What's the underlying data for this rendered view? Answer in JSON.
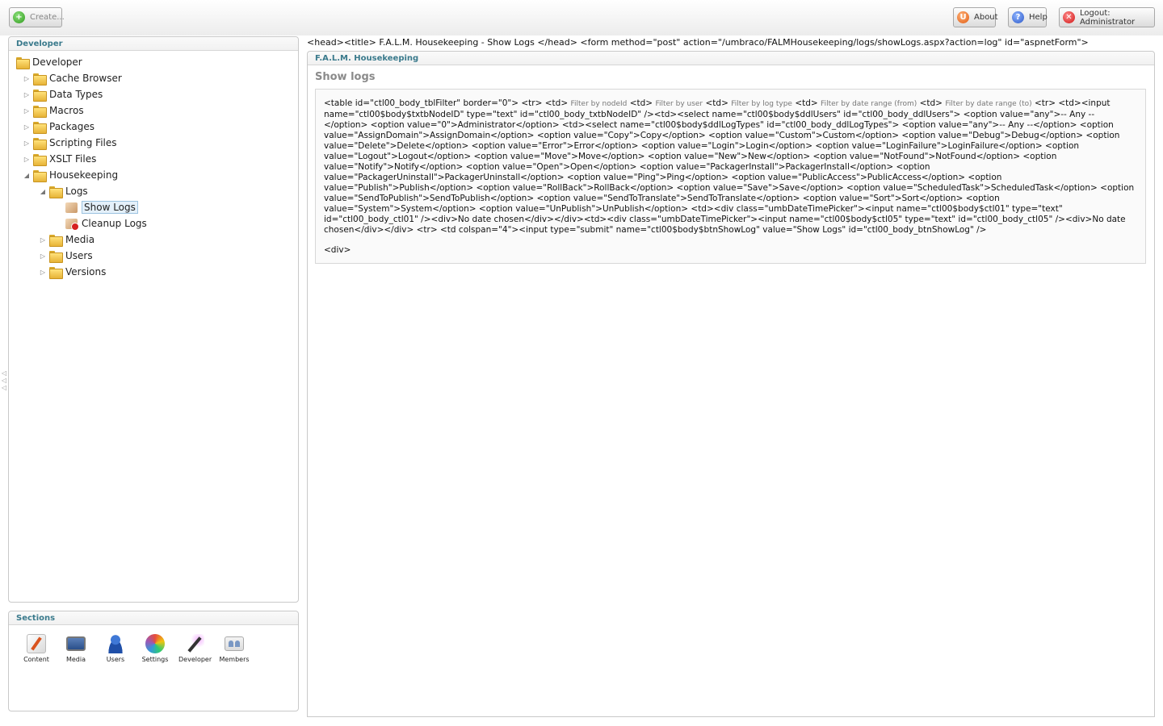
{
  "toolbar": {
    "create_label": "Create...",
    "about_label": "About",
    "help_label": "Help",
    "logout_label": "Logout: Administrator"
  },
  "tree_panel": {
    "title": "Developer",
    "root": "Developer",
    "items": [
      {
        "label": "Cache Browser"
      },
      {
        "label": "Data Types"
      },
      {
        "label": "Macros"
      },
      {
        "label": "Packages"
      },
      {
        "label": "Scripting Files"
      },
      {
        "label": "XSLT Files"
      },
      {
        "label": "Housekeeping"
      },
      {
        "label": "Logs"
      },
      {
        "label": "Show Logs"
      },
      {
        "label": "Cleanup Logs"
      },
      {
        "label": "Media"
      },
      {
        "label": "Users"
      },
      {
        "label": "Versions"
      }
    ]
  },
  "sections_panel": {
    "title": "Sections",
    "items": [
      {
        "label": "Content",
        "icon": "content-icon"
      },
      {
        "label": "Media",
        "icon": "media-icon"
      },
      {
        "label": "Users",
        "icon": "users-icon"
      },
      {
        "label": "Settings",
        "icon": "settings-icon"
      },
      {
        "label": "Developer",
        "icon": "developer-icon"
      },
      {
        "label": "Members",
        "icon": "members-icon"
      }
    ]
  },
  "main": {
    "raw_head": "<head><title> F.A.L.M. Housekeeping - Show Logs </head> <form method=\"post\" action=\"/umbraco/FALMHousekeeping/logs/showLogs.aspx?action=log\" id=\"aspnetForm\">",
    "panel_title": "F.A.L.M. Housekeeping",
    "page_title": "Show logs",
    "code_part1": "<table id=\"ctl00_body_tblFilter\" border=\"0\"> <tr> <td>",
    "filter_nodeid": "Filter by nodeId",
    "code_td1": "<td>",
    "filter_user": "Filter by user",
    "code_td2": "<td>",
    "filter_logtype": "Filter by log type",
    "code_td3": "<td>",
    "filter_from": "Filter by date range (from)",
    "code_td4": "<td>",
    "filter_to": "Filter by date range (to)",
    "code_part2": "<tr> <td><input name=\"ctl00$body$txtbNodeID\" type=\"text\" id=\"ctl00_body_txtbNodeID\" /><td><select name=\"ctl00$body$ddlUsers\" id=\"ctl00_body_ddlUsers\"> <option value=\"any\">-- Any --</option> <option value=\"0\">Administrator</option> <td><select name=\"ctl00$body$ddlLogTypes\" id=\"ctl00_body_ddlLogTypes\"> <option value=\"any\">-- Any --</option> <option value=\"AssignDomain\">AssignDomain</option> <option value=\"Copy\">Copy</option> <option value=\"Custom\">Custom</option> <option value=\"Debug\">Debug</option> <option value=\"Delete\">Delete</option> <option value=\"Error\">Error</option> <option value=\"Login\">Login</option> <option value=\"LoginFailure\">LoginFailure</option> <option value=\"Logout\">Logout</option> <option value=\"Move\">Move</option> <option value=\"New\">New</option> <option value=\"NotFound\">NotFound</option> <option value=\"Notify\">Notify</option> <option value=\"Open\">Open</option> <option value=\"PackagerInstall\">PackagerInstall</option> <option value=\"PackagerUninstall\">PackagerUninstall</option> <option value=\"Ping\">Ping</option> <option value=\"PublicAccess\">PublicAccess</option> <option value=\"Publish\">Publish</option> <option value=\"RollBack\">RollBack</option> <option value=\"Save\">Save</option> <option value=\"ScheduledTask\">ScheduledTask</option> <option value=\"SendToPublish\">SendToPublish</option> <option value=\"SendToTranslate\">SendToTranslate</option> <option value=\"Sort\">Sort</option> <option value=\"System\">System</option> <option value=\"UnPublish\">UnPublish</option> <td><div class=\"umbDateTimePicker\"><input name=\"ctl00$body$ctl01\" type=\"text\" id=\"ctl00_body_ctl01\" /><div>No date chosen</div></div><td><div class=\"umbDateTimePicker\"><input name=\"ctl00$body$ctl05\" type=\"text\" id=\"ctl00_body_ctl05\" /><div>No date chosen</div></div> <tr> <td colspan=\"4\"><input type=\"submit\" name=\"ctl00$body$btnShowLog\" value=\"Show Logs\" id=\"ctl00_body_btnShowLog\" />",
    "code_div": "<div>"
  }
}
